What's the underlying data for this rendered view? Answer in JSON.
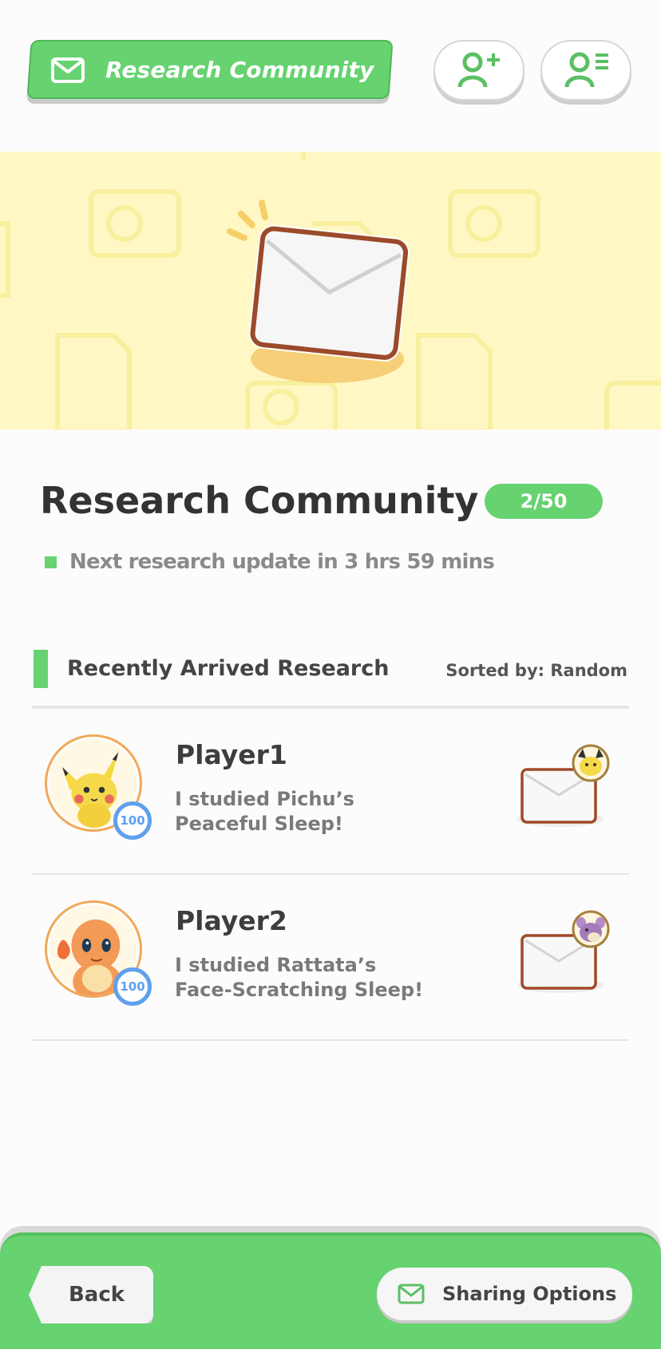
{
  "header": {
    "title": "Research Community",
    "add_friend_icon": "person-plus-icon",
    "friend_list_icon": "person-list-icon",
    "accent_color": "#66d270"
  },
  "banner": {
    "illustration": "envelope-icon"
  },
  "main": {
    "title": "Research Community",
    "count": "2/50",
    "update_text": "Next research update in 3 hrs 59 mins"
  },
  "list": {
    "header": "Recently Arrived Research",
    "sort": "Sorted by: Random",
    "items": [
      {
        "player": "Player1",
        "level": "100",
        "message_line1": "I studied Pichu’s",
        "message_line2": "Peaceful Sleep!",
        "avatar": "pikachu-avatar",
        "pokemon_icon": "pichu-icon"
      },
      {
        "player": "Player2",
        "level": "100",
        "message_line1": "I studied Rattata’s",
        "message_line2": "Face-Scratching Sleep!",
        "avatar": "charmander-avatar",
        "pokemon_icon": "rattata-icon"
      }
    ]
  },
  "footer": {
    "back_label": "Back",
    "share_label": "Sharing Options"
  }
}
